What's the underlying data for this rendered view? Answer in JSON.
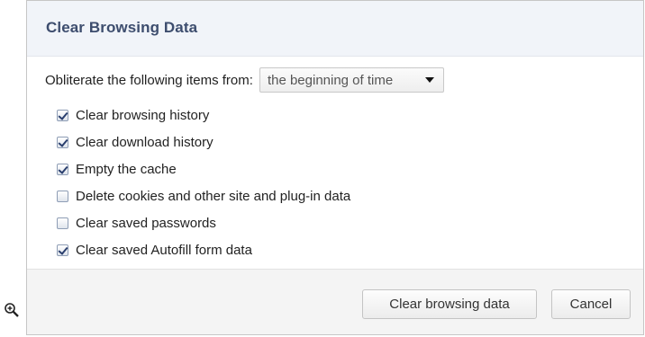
{
  "dialog": {
    "title": "Clear Browsing Data",
    "range_label": "Obliterate the following items from:",
    "range_selected": "the beginning of time",
    "options": [
      {
        "label": "Clear browsing history",
        "checked": true
      },
      {
        "label": "Clear download history",
        "checked": true
      },
      {
        "label": "Empty the cache",
        "checked": true
      },
      {
        "label": "Delete cookies and other site and plug-in data",
        "checked": false
      },
      {
        "label": "Clear saved passwords",
        "checked": false
      },
      {
        "label": "Clear saved Autofill form data",
        "checked": true
      }
    ],
    "buttons": {
      "clear": "Clear browsing data",
      "cancel": "Cancel"
    }
  },
  "icons": {
    "zoom": "zoom-in-icon"
  }
}
